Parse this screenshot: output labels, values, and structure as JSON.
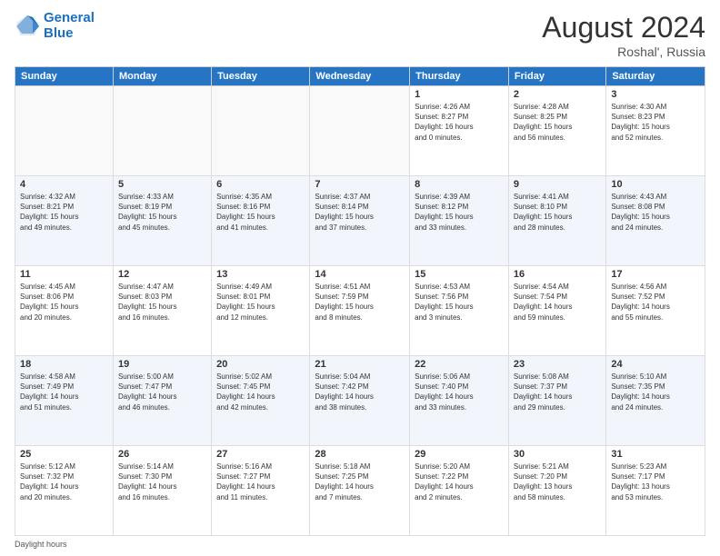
{
  "header": {
    "logo_line1": "General",
    "logo_line2": "Blue",
    "month": "August 2024",
    "location": "Roshal', Russia"
  },
  "weekdays": [
    "Sunday",
    "Monday",
    "Tuesday",
    "Wednesday",
    "Thursday",
    "Friday",
    "Saturday"
  ],
  "footer": {
    "label": "Daylight hours"
  },
  "weeks": [
    [
      {
        "day": "",
        "info": ""
      },
      {
        "day": "",
        "info": ""
      },
      {
        "day": "",
        "info": ""
      },
      {
        "day": "",
        "info": ""
      },
      {
        "day": "1",
        "info": "Sunrise: 4:26 AM\nSunset: 8:27 PM\nDaylight: 16 hours\nand 0 minutes."
      },
      {
        "day": "2",
        "info": "Sunrise: 4:28 AM\nSunset: 8:25 PM\nDaylight: 15 hours\nand 56 minutes."
      },
      {
        "day": "3",
        "info": "Sunrise: 4:30 AM\nSunset: 8:23 PM\nDaylight: 15 hours\nand 52 minutes."
      }
    ],
    [
      {
        "day": "4",
        "info": "Sunrise: 4:32 AM\nSunset: 8:21 PM\nDaylight: 15 hours\nand 49 minutes."
      },
      {
        "day": "5",
        "info": "Sunrise: 4:33 AM\nSunset: 8:19 PM\nDaylight: 15 hours\nand 45 minutes."
      },
      {
        "day": "6",
        "info": "Sunrise: 4:35 AM\nSunset: 8:16 PM\nDaylight: 15 hours\nand 41 minutes."
      },
      {
        "day": "7",
        "info": "Sunrise: 4:37 AM\nSunset: 8:14 PM\nDaylight: 15 hours\nand 37 minutes."
      },
      {
        "day": "8",
        "info": "Sunrise: 4:39 AM\nSunset: 8:12 PM\nDaylight: 15 hours\nand 33 minutes."
      },
      {
        "day": "9",
        "info": "Sunrise: 4:41 AM\nSunset: 8:10 PM\nDaylight: 15 hours\nand 28 minutes."
      },
      {
        "day": "10",
        "info": "Sunrise: 4:43 AM\nSunset: 8:08 PM\nDaylight: 15 hours\nand 24 minutes."
      }
    ],
    [
      {
        "day": "11",
        "info": "Sunrise: 4:45 AM\nSunset: 8:06 PM\nDaylight: 15 hours\nand 20 minutes."
      },
      {
        "day": "12",
        "info": "Sunrise: 4:47 AM\nSunset: 8:03 PM\nDaylight: 15 hours\nand 16 minutes."
      },
      {
        "day": "13",
        "info": "Sunrise: 4:49 AM\nSunset: 8:01 PM\nDaylight: 15 hours\nand 12 minutes."
      },
      {
        "day": "14",
        "info": "Sunrise: 4:51 AM\nSunset: 7:59 PM\nDaylight: 15 hours\nand 8 minutes."
      },
      {
        "day": "15",
        "info": "Sunrise: 4:53 AM\nSunset: 7:56 PM\nDaylight: 15 hours\nand 3 minutes."
      },
      {
        "day": "16",
        "info": "Sunrise: 4:54 AM\nSunset: 7:54 PM\nDaylight: 14 hours\nand 59 minutes."
      },
      {
        "day": "17",
        "info": "Sunrise: 4:56 AM\nSunset: 7:52 PM\nDaylight: 14 hours\nand 55 minutes."
      }
    ],
    [
      {
        "day": "18",
        "info": "Sunrise: 4:58 AM\nSunset: 7:49 PM\nDaylight: 14 hours\nand 51 minutes."
      },
      {
        "day": "19",
        "info": "Sunrise: 5:00 AM\nSunset: 7:47 PM\nDaylight: 14 hours\nand 46 minutes."
      },
      {
        "day": "20",
        "info": "Sunrise: 5:02 AM\nSunset: 7:45 PM\nDaylight: 14 hours\nand 42 minutes."
      },
      {
        "day": "21",
        "info": "Sunrise: 5:04 AM\nSunset: 7:42 PM\nDaylight: 14 hours\nand 38 minutes."
      },
      {
        "day": "22",
        "info": "Sunrise: 5:06 AM\nSunset: 7:40 PM\nDaylight: 14 hours\nand 33 minutes."
      },
      {
        "day": "23",
        "info": "Sunrise: 5:08 AM\nSunset: 7:37 PM\nDaylight: 14 hours\nand 29 minutes."
      },
      {
        "day": "24",
        "info": "Sunrise: 5:10 AM\nSunset: 7:35 PM\nDaylight: 14 hours\nand 24 minutes."
      }
    ],
    [
      {
        "day": "25",
        "info": "Sunrise: 5:12 AM\nSunset: 7:32 PM\nDaylight: 14 hours\nand 20 minutes."
      },
      {
        "day": "26",
        "info": "Sunrise: 5:14 AM\nSunset: 7:30 PM\nDaylight: 14 hours\nand 16 minutes."
      },
      {
        "day": "27",
        "info": "Sunrise: 5:16 AM\nSunset: 7:27 PM\nDaylight: 14 hours\nand 11 minutes."
      },
      {
        "day": "28",
        "info": "Sunrise: 5:18 AM\nSunset: 7:25 PM\nDaylight: 14 hours\nand 7 minutes."
      },
      {
        "day": "29",
        "info": "Sunrise: 5:20 AM\nSunset: 7:22 PM\nDaylight: 14 hours\nand 2 minutes."
      },
      {
        "day": "30",
        "info": "Sunrise: 5:21 AM\nSunset: 7:20 PM\nDaylight: 13 hours\nand 58 minutes."
      },
      {
        "day": "31",
        "info": "Sunrise: 5:23 AM\nSunset: 7:17 PM\nDaylight: 13 hours\nand 53 minutes."
      }
    ]
  ]
}
